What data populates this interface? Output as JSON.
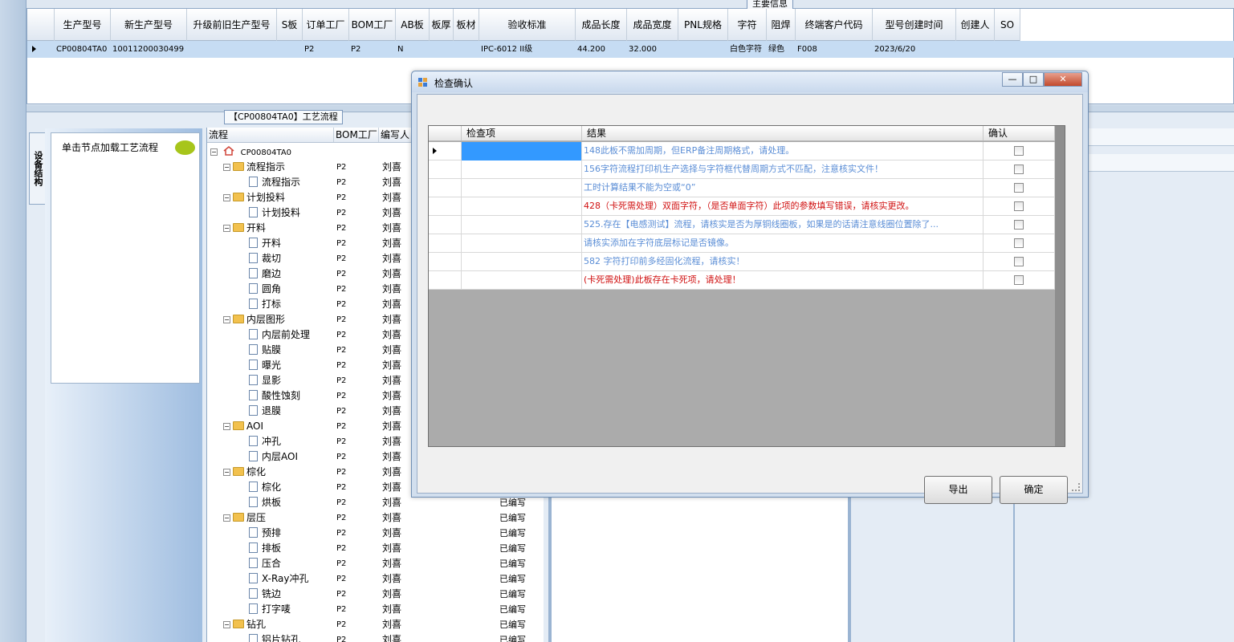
{
  "main_grid": {
    "section_title": "主要信息",
    "columns": [
      "生产型号",
      "新生产型号",
      "升级前旧生产型号",
      "S板",
      "订单工厂",
      "BOM工厂",
      "AB板",
      "板厚",
      "板材",
      "验收标准",
      "成品长度",
      "成品宽度",
      "PNL规格",
      "字符",
      "阻焊",
      "终端客户代码",
      "型号创建时间",
      "创建人",
      "SO"
    ],
    "row": [
      "CP00804TA0",
      "10011200030499",
      "",
      "",
      "P2",
      "P2",
      "N",
      "",
      "",
      "IPC-6012 II级",
      "44.200",
      "32.000",
      "",
      "白色字符",
      "绿色",
      "F008",
      "2023/6/20",
      "",
      ""
    ]
  },
  "side_tab": "设备结构",
  "node_hint": "单击节点加载工艺流程",
  "process": {
    "title": "【CP00804TA0】工艺流程",
    "headers": [
      "流程",
      "BOM工厂",
      "编写人"
    ],
    "root": "CP00804TA0",
    "rows": [
      {
        "name": "流程指示",
        "level": 1,
        "folder": true,
        "factory": "P2",
        "author": "刘喜",
        "status": ""
      },
      {
        "name": "流程指示",
        "level": 2,
        "folder": false,
        "factory": "P2",
        "author": "刘喜",
        "status": ""
      },
      {
        "name": "计划投料",
        "level": 1,
        "folder": true,
        "factory": "P2",
        "author": "刘喜",
        "status": ""
      },
      {
        "name": "计划投料",
        "level": 2,
        "folder": false,
        "factory": "P2",
        "author": "刘喜",
        "status": ""
      },
      {
        "name": "开料",
        "level": 1,
        "folder": true,
        "factory": "P2",
        "author": "刘喜",
        "status": ""
      },
      {
        "name": "开料",
        "level": 2,
        "folder": false,
        "factory": "P2",
        "author": "刘喜",
        "status": ""
      },
      {
        "name": "裁切",
        "level": 2,
        "folder": false,
        "factory": "P2",
        "author": "刘喜",
        "status": ""
      },
      {
        "name": "磨边",
        "level": 2,
        "folder": false,
        "factory": "P2",
        "author": "刘喜",
        "status": ""
      },
      {
        "name": "圆角",
        "level": 2,
        "folder": false,
        "factory": "P2",
        "author": "刘喜",
        "status": ""
      },
      {
        "name": "打标",
        "level": 2,
        "folder": false,
        "factory": "P2",
        "author": "刘喜",
        "status": ""
      },
      {
        "name": "内层图形",
        "level": 1,
        "folder": true,
        "factory": "P2",
        "author": "刘喜",
        "status": ""
      },
      {
        "name": "内层前处理",
        "level": 2,
        "folder": false,
        "factory": "P2",
        "author": "刘喜",
        "status": ""
      },
      {
        "name": "贴膜",
        "level": 2,
        "folder": false,
        "factory": "P2",
        "author": "刘喜",
        "status": ""
      },
      {
        "name": "曝光",
        "level": 2,
        "folder": false,
        "factory": "P2",
        "author": "刘喜",
        "status": ""
      },
      {
        "name": "显影",
        "level": 2,
        "folder": false,
        "factory": "P2",
        "author": "刘喜",
        "status": ""
      },
      {
        "name": "酸性蚀刻",
        "level": 2,
        "folder": false,
        "factory": "P2",
        "author": "刘喜",
        "status": ""
      },
      {
        "name": "退膜",
        "level": 2,
        "folder": false,
        "factory": "P2",
        "author": "刘喜",
        "status": ""
      },
      {
        "name": "AOI",
        "level": 1,
        "folder": true,
        "factory": "P2",
        "author": "刘喜",
        "status": ""
      },
      {
        "name": "冲孔",
        "level": 2,
        "folder": false,
        "factory": "P2",
        "author": "刘喜",
        "status": ""
      },
      {
        "name": "内层AOI",
        "level": 2,
        "folder": false,
        "factory": "P2",
        "author": "刘喜",
        "status": ""
      },
      {
        "name": "棕化",
        "level": 1,
        "folder": true,
        "factory": "P2",
        "author": "刘喜",
        "status": ""
      },
      {
        "name": "棕化",
        "level": 2,
        "folder": false,
        "factory": "P2",
        "author": "刘喜",
        "status": ""
      },
      {
        "name": "烘板",
        "level": 2,
        "folder": false,
        "factory": "P2",
        "author": "刘喜",
        "status": "已编写"
      },
      {
        "name": "层压",
        "level": 1,
        "folder": true,
        "factory": "P2",
        "author": "刘喜",
        "status": "已编写"
      },
      {
        "name": "预排",
        "level": 2,
        "folder": false,
        "factory": "P2",
        "author": "刘喜",
        "status": "已编写"
      },
      {
        "name": "排板",
        "level": 2,
        "folder": false,
        "factory": "P2",
        "author": "刘喜",
        "status": "已编写"
      },
      {
        "name": "压合",
        "level": 2,
        "folder": false,
        "factory": "P2",
        "author": "刘喜",
        "status": "已编写"
      },
      {
        "name": "X-Ray冲孔",
        "level": 2,
        "folder": false,
        "factory": "P2",
        "author": "刘喜",
        "status": "已编写"
      },
      {
        "name": "铣边",
        "level": 2,
        "folder": false,
        "factory": "P2",
        "author": "刘喜",
        "status": "已编写"
      },
      {
        "name": "打字唛",
        "level": 2,
        "folder": false,
        "factory": "P2",
        "author": "刘喜",
        "status": "已编写"
      },
      {
        "name": "钻孔",
        "level": 1,
        "folder": true,
        "factory": "P2",
        "author": "刘喜",
        "status": "已编写"
      },
      {
        "name": "铝片钻孔",
        "level": 2,
        "folder": false,
        "factory": "P2",
        "author": "刘喜",
        "status": "已编写"
      }
    ]
  },
  "dialog": {
    "title": "检查确认",
    "headers": {
      "item": "检查项",
      "result": "结果",
      "confirm": "确认"
    },
    "rows": [
      {
        "item": "",
        "result": "148此板不需加周期，但ERP备注周期格式，请处理。",
        "color": "blue",
        "selected": true
      },
      {
        "item": "",
        "result": "156字符流程打印机生产选择与字符框代替周期方式不匹配，注意核实文件！",
        "color": "blue",
        "selected": false
      },
      {
        "item": "",
        "result": "工时计算结果不能为空或“0”",
        "color": "blue",
        "selected": false
      },
      {
        "item": "",
        "result": "428（卡死需处理）双面字符，（是否单面字符）此项的参数填写错误，请核实更改。",
        "color": "red",
        "selected": false
      },
      {
        "item": "",
        "result": "525.存在【电感测试】流程，请核实是否为厚铜线圈板，如果是的话请注意线圈位置除了...",
        "color": "blue",
        "selected": false
      },
      {
        "item": "",
        "result": "请核实添加在字符底层标记是否镜像。",
        "color": "blue",
        "selected": false
      },
      {
        "item": "",
        "result": "582 字符打印前多经固化流程，请核实！",
        "color": "blue",
        "selected": false
      },
      {
        "item": "",
        "result": "(卡死需处理)此板存在卡死项，请处理！",
        "color": "red",
        "selected": false
      }
    ],
    "export_label": "导出",
    "ok_label": "确定",
    "min_label": "—",
    "max_label": "□",
    "close_label": "✕"
  }
}
